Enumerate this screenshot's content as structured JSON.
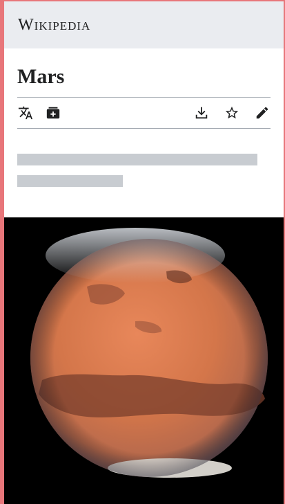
{
  "header": {
    "wordmark": "Wikipedia"
  },
  "page": {
    "title": "Mars"
  },
  "actions": {
    "left": [
      {
        "name": "language-icon"
      },
      {
        "name": "add-to-reading-list-icon"
      }
    ],
    "right": [
      {
        "name": "download-icon"
      },
      {
        "name": "star-watch-icon"
      },
      {
        "name": "edit-pencil-icon"
      }
    ]
  },
  "colors": {
    "header_bg": "#eaecf0",
    "skeleton": "#c8ccd1",
    "border_accent": "#e8767a",
    "planet": "#d4764a"
  },
  "image": {
    "subject": "planet-mars-photo"
  }
}
